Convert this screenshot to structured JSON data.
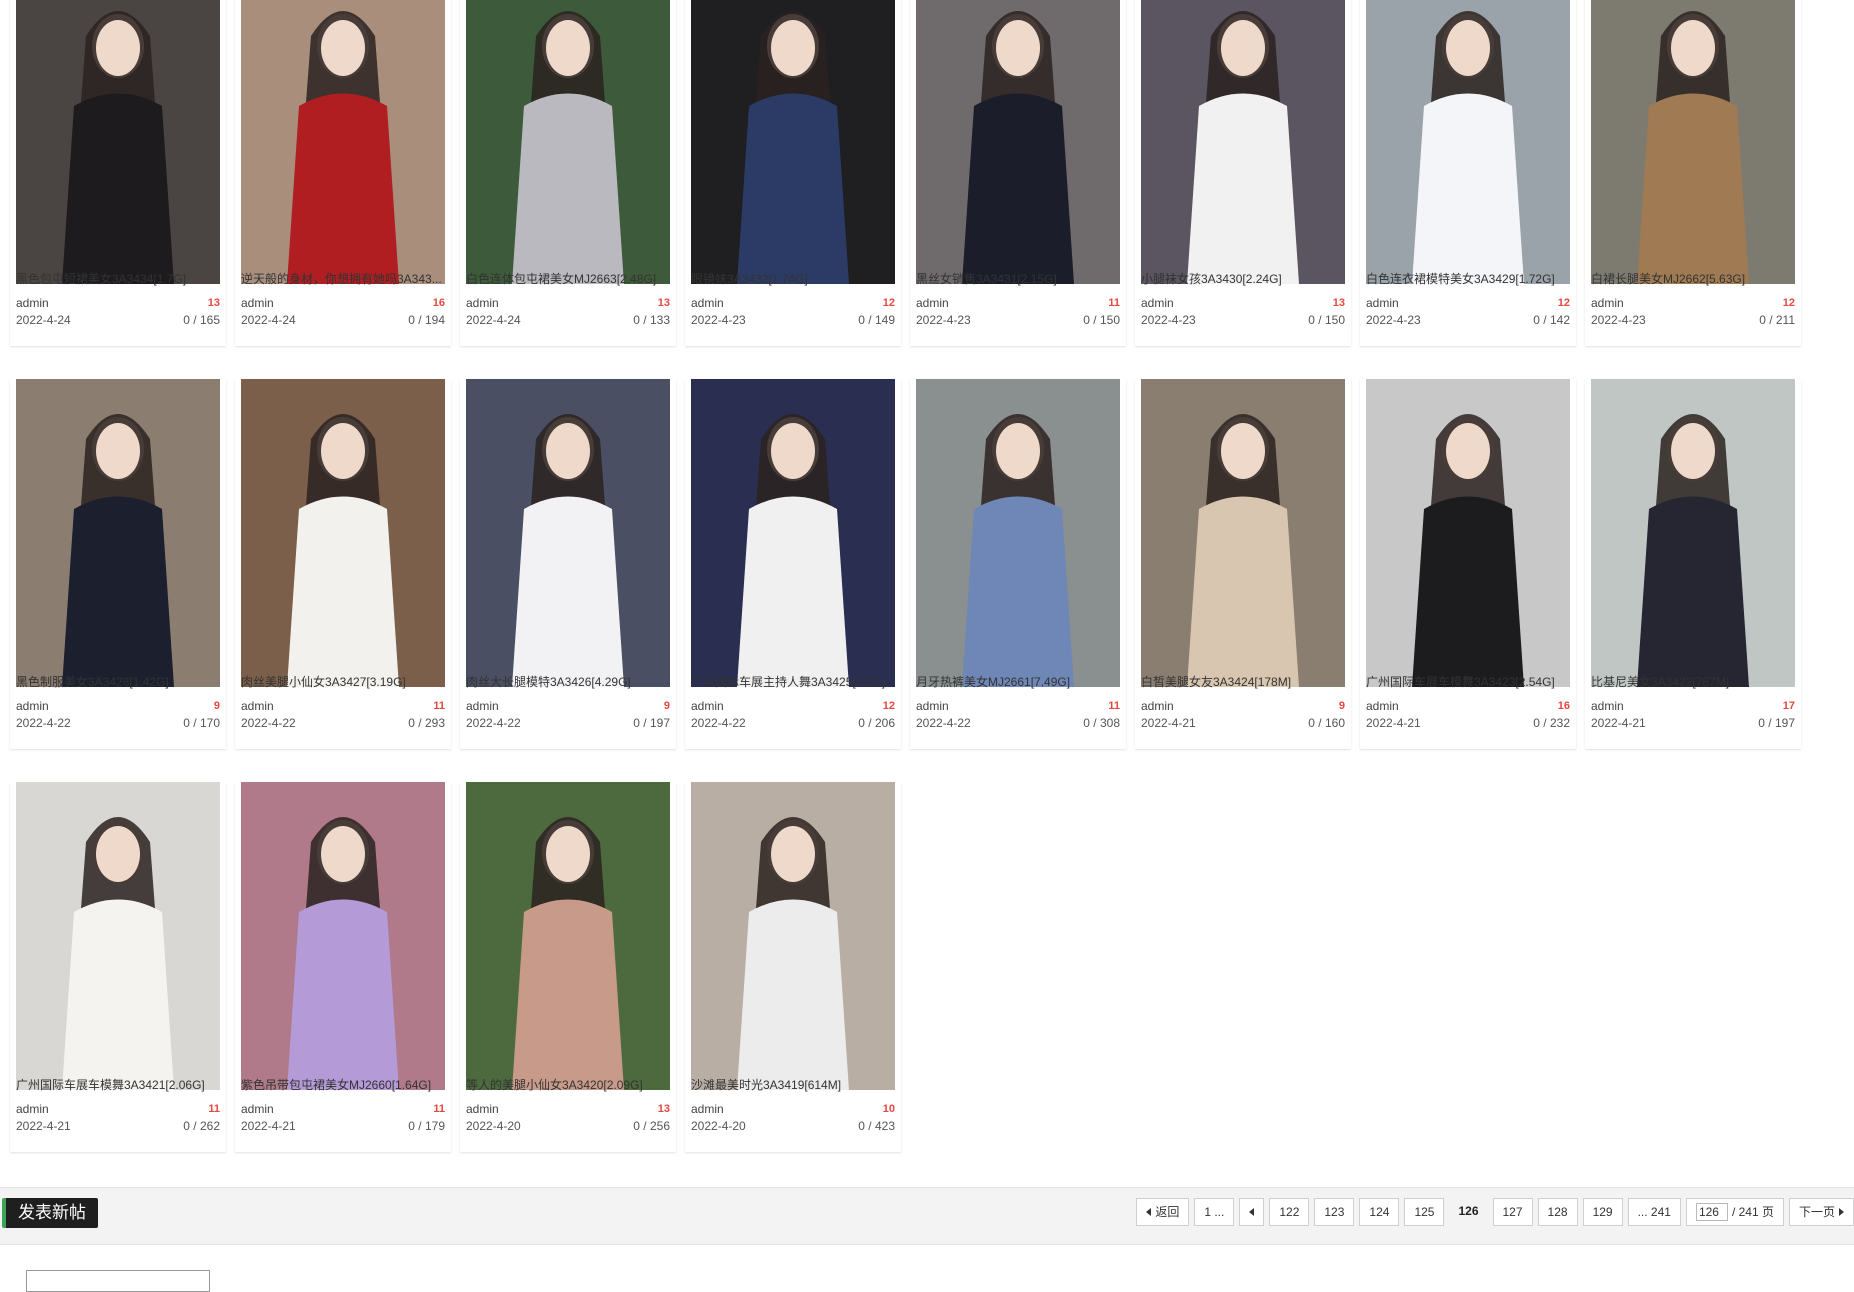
{
  "posts": [
    {
      "title": "黑色包屯短裙美女3A3434[1.7G]",
      "author": "admin",
      "count": "13",
      "date": "2022-4-24",
      "views": "0 / 165",
      "bg": "#4a4542",
      "fg": "#1d1b1e"
    },
    {
      "title": "逆天般的身材，你想拥有她吗3A343...",
      "author": "admin",
      "count": "16",
      "date": "2022-4-24",
      "views": "0 / 194",
      "bg": "#a98e7c",
      "fg": "#b11e22"
    },
    {
      "title": "白色连体包屯裙美女MJ2663[2.48G]",
      "author": "admin",
      "count": "13",
      "date": "2022-4-24",
      "views": "0 / 133",
      "bg": "#3d5a3a",
      "fg": "#b9b9bf"
    },
    {
      "title": "眼镜妹3A3432[1.74G]",
      "author": "admin",
      "count": "12",
      "date": "2022-4-23",
      "views": "0 / 149",
      "bg": "#1f1f22",
      "fg": "#2b3b66"
    },
    {
      "title": "黑丝女销售3A3431[2.15G]",
      "author": "admin",
      "count": "11",
      "date": "2022-4-23",
      "views": "0 / 150",
      "bg": "#6f6a6b",
      "fg": "#1b1d2a"
    },
    {
      "title": "小腿袜女孩3A3430[2.24G]",
      "author": "admin",
      "count": "13",
      "date": "2022-4-23",
      "views": "0 / 150",
      "bg": "#5a5560",
      "fg": "#f1f1f1"
    },
    {
      "title": "白色连衣裙模特美女3A3429[1.72G]",
      "author": "admin",
      "count": "12",
      "date": "2022-4-23",
      "views": "0 / 142",
      "bg": "#9aa3aa",
      "fg": "#f4f5f8"
    },
    {
      "title": "白裙长腿美女MJ2662[5.63G]",
      "author": "admin",
      "count": "12",
      "date": "2022-4-23",
      "views": "0 / 211",
      "bg": "#7d7a70",
      "fg": "#a07a52"
    },
    {
      "title": "黑色制服美女3A3428[1.42G]",
      "author": "admin",
      "count": "9",
      "date": "2022-4-22",
      "views": "0 / 170",
      "bg": "#8b7d70",
      "fg": "#1b1f2e"
    },
    {
      "title": "肉丝美腿小仙女3A3427[3.19G]",
      "author": "admin",
      "count": "11",
      "date": "2022-4-22",
      "views": "0 / 293",
      "bg": "#7b5f4a",
      "fg": "#f3f1ee"
    },
    {
      "title": "肉丝大长腿模特3A3426[4.29G]",
      "author": "admin",
      "count": "9",
      "date": "2022-4-22",
      "views": "0 / 197",
      "bg": "#4a4f63",
      "fg": "#f2f2f4"
    },
    {
      "title": "广州国际车展主持人舞3A3425[2.3G]",
      "author": "admin",
      "count": "12",
      "date": "2022-4-22",
      "views": "0 / 206",
      "bg": "#2a2f52",
      "fg": "#f0f0f0"
    },
    {
      "title": "月牙热裤美女MJ2661[7.49G]",
      "author": "admin",
      "count": "11",
      "date": "2022-4-22",
      "views": "0 / 308",
      "bg": "#8a8f8f",
      "fg": "#6f87b6"
    },
    {
      "title": "白皙美腿女友3A3424[178M]",
      "author": "admin",
      "count": "9",
      "date": "2022-4-21",
      "views": "0 / 160",
      "bg": "#8a7e70",
      "fg": "#d9c6b0"
    },
    {
      "title": "广州国际车展车模舞3A3423[2.54G]",
      "author": "admin",
      "count": "16",
      "date": "2022-4-21",
      "views": "0 / 232",
      "bg": "#c8c8c8",
      "fg": "#1c1c1e"
    },
    {
      "title": "比基尼美女3A3422[787M]",
      "author": "admin",
      "count": "17",
      "date": "2022-4-21",
      "views": "0 / 197",
      "bg": "#bfc6c4",
      "fg": "#262633"
    },
    {
      "title": "广州国际车展车模舞3A3421[2.06G]",
      "author": "admin",
      "count": "11",
      "date": "2022-4-21",
      "views": "0 / 262",
      "bg": "#d9d7d4",
      "fg": "#f5f3ef"
    },
    {
      "title": "紫色吊带包屯裙美女MJ2660[1.64G]",
      "author": "admin",
      "count": "11",
      "date": "2022-4-21",
      "views": "0 / 179",
      "bg": "#b07a8a",
      "fg": "#b49ad6"
    },
    {
      "title": "等人的美腿小仙女3A3420[2.09G]",
      "author": "admin",
      "count": "13",
      "date": "2022-4-20",
      "views": "0 / 256",
      "bg": "#4d6a3e",
      "fg": "#c89a8a"
    },
    {
      "title": "沙滩最美时光3A3419[614M]",
      "author": "admin",
      "count": "10",
      "date": "2022-4-20",
      "views": "0 / 423",
      "bg": "#b8aea4",
      "fg": "#ececec"
    }
  ],
  "bottombar": {
    "new_post_label": "发表新帖",
    "pager": {
      "back_label": "返回",
      "first_label": "1 ...",
      "pages": [
        "122",
        "123",
        "124",
        "125",
        "126",
        "127",
        "128",
        "129"
      ],
      "current": "126",
      "last_label": "... 241",
      "page_input_value": "126",
      "total_label": "/ 241 页",
      "next_label": "下一页"
    }
  },
  "colors": {
    "accent_red": "#e5483e",
    "new_post_bg": "#1f1f1f",
    "bar_bg": "#f3f3f3"
  }
}
